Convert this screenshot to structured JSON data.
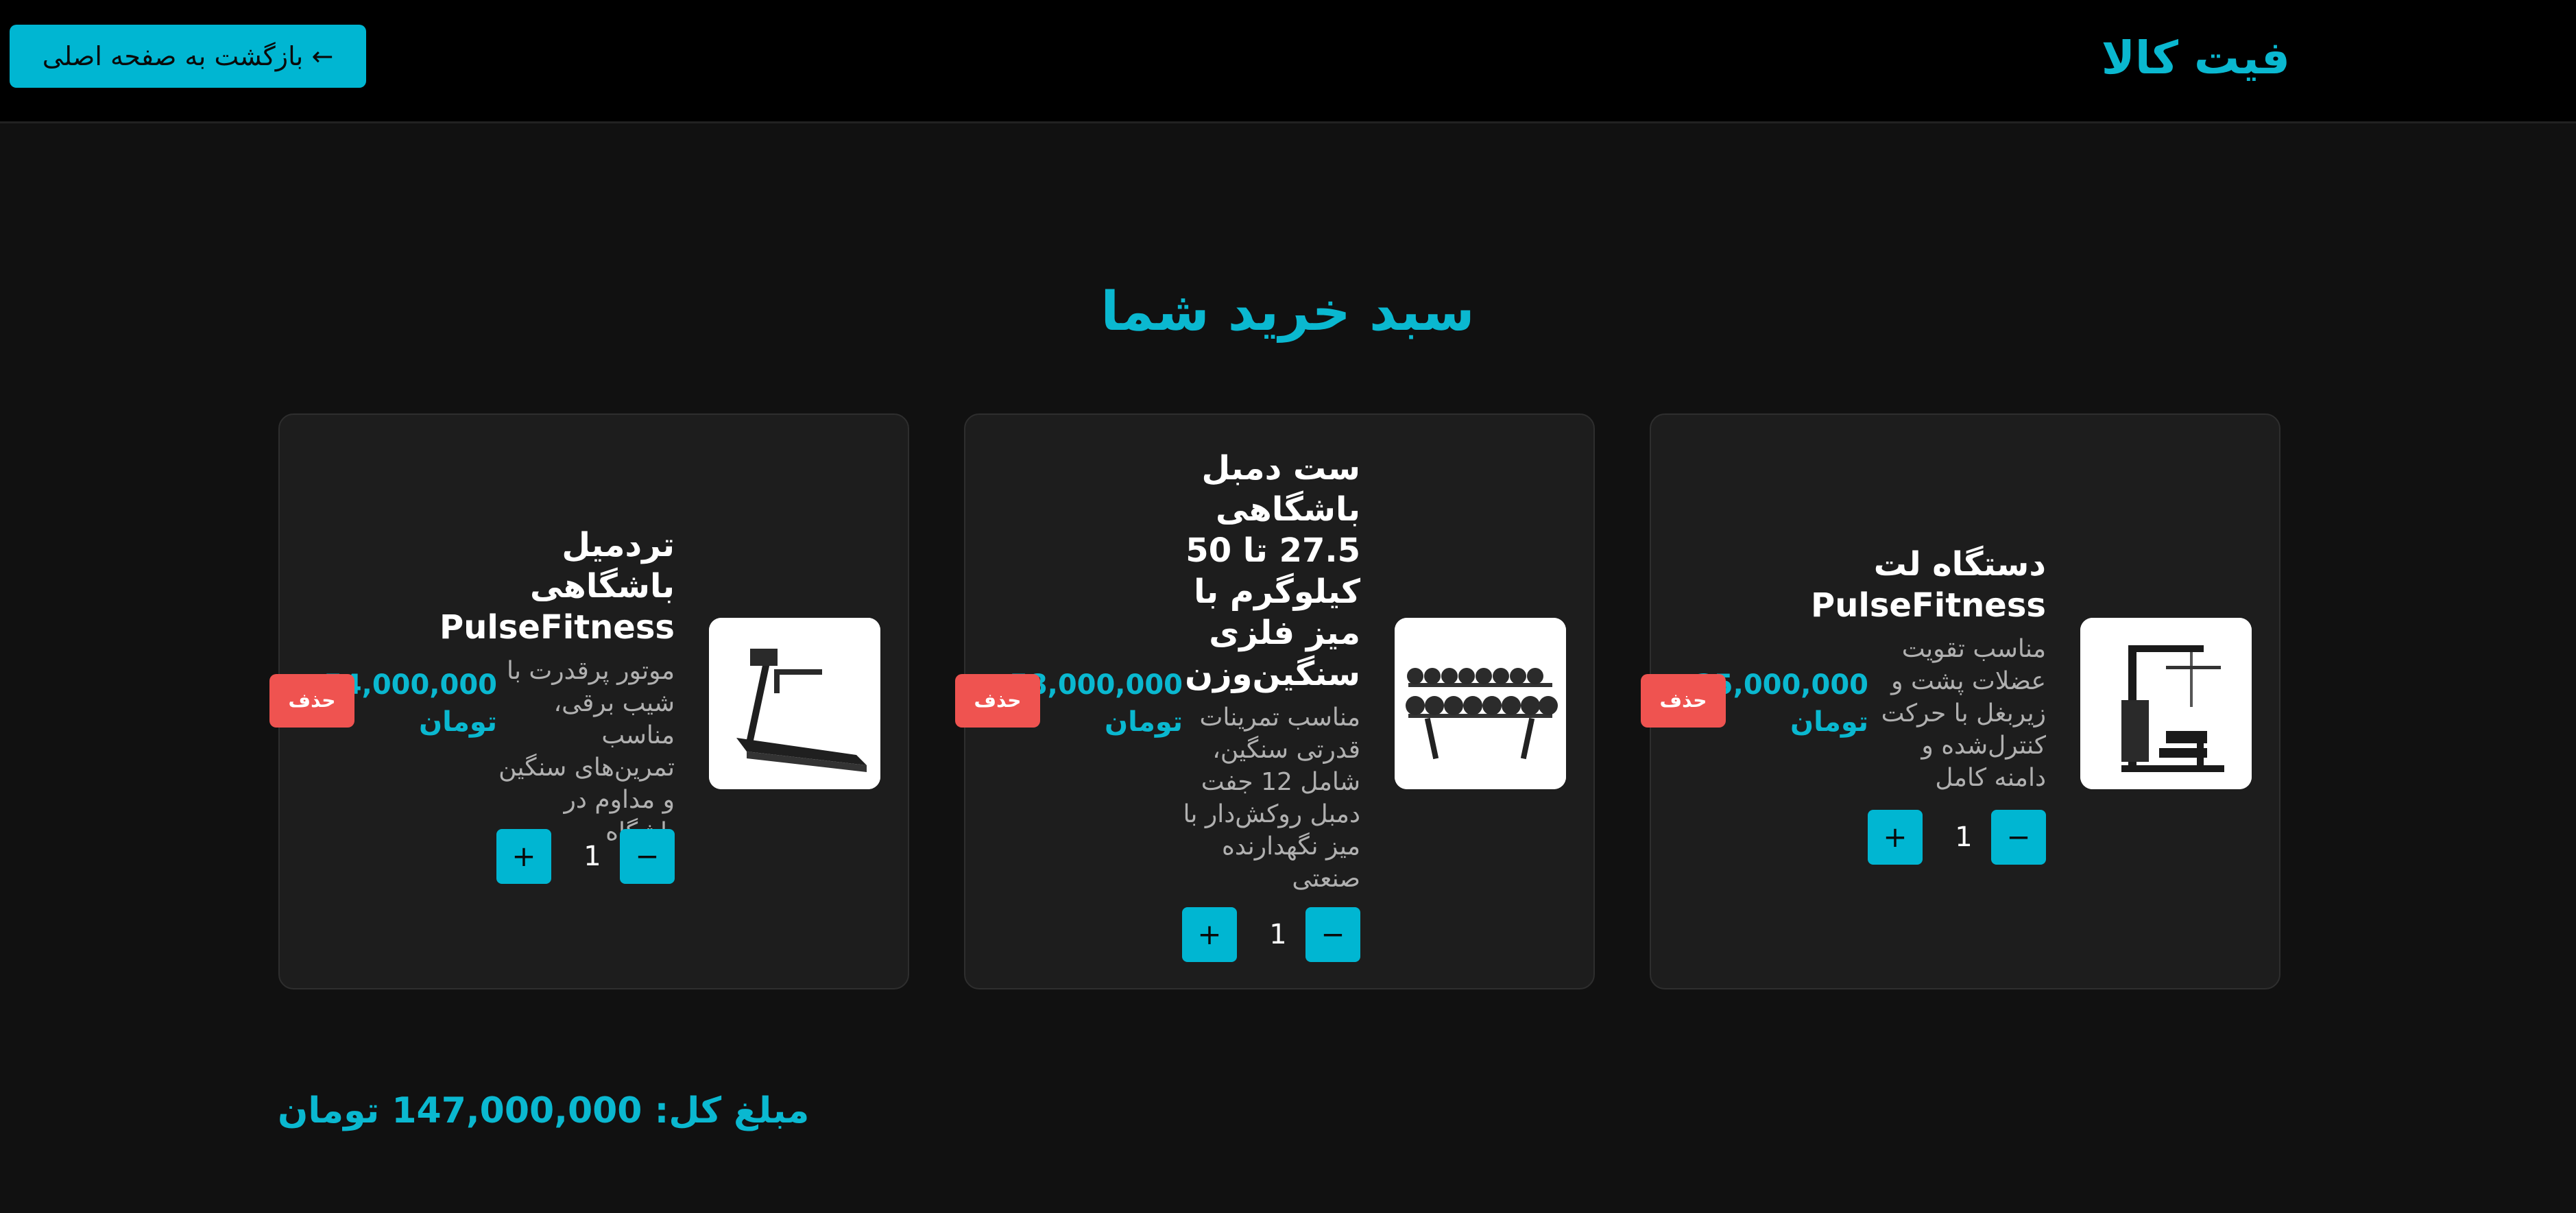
{
  "header": {
    "logo": "فیت کالا",
    "back_button": "← بازگشت به صفحه اصلی"
  },
  "page_title": "سبد خرید شما",
  "cart": {
    "items": [
      {
        "title": "دستگاه لت PulseFitness",
        "description": "مناسب تقویت عضلات پشت و زیربغل با حرکت کنترل‌شده و دامنه کامل",
        "quantity": "1",
        "price": "35,000,000 تومان",
        "delete_label": "حذف",
        "image_icon": "lat-machine-icon"
      },
      {
        "title": "ست دمبل باشگاهی 27.5 تا 50 کیلوگرم با میز فلزی سنگین‌وزن",
        "description": "مناسب تمرینات قدرتی سنگین، شامل 12 جفت دمبل روکش‌دار با میز نگهدارنده صنعتی",
        "quantity": "1",
        "price": "58,000,000 تومان",
        "delete_label": "حذف",
        "image_icon": "dumbbell-rack-icon"
      },
      {
        "title": "تردمیل باشگاهی PulseFitness",
        "description": "موتور پرقدرت با شیب برقی، مناسب تمرین‌های سنگین و مداوم در باشگاه",
        "quantity": "1",
        "price": "54,000,000 تومان",
        "delete_label": "حذف",
        "image_icon": "treadmill-icon"
      }
    ],
    "minus_label": "−",
    "plus_label": "+"
  },
  "total": {
    "label": "مبلغ کل:",
    "amount": "147,000,000 تومان"
  },
  "colors": {
    "accent": "#0ab8d0",
    "button": "#00b6d2",
    "danger": "#ef5350",
    "background": "#111111",
    "card": "#1d1d1d"
  }
}
